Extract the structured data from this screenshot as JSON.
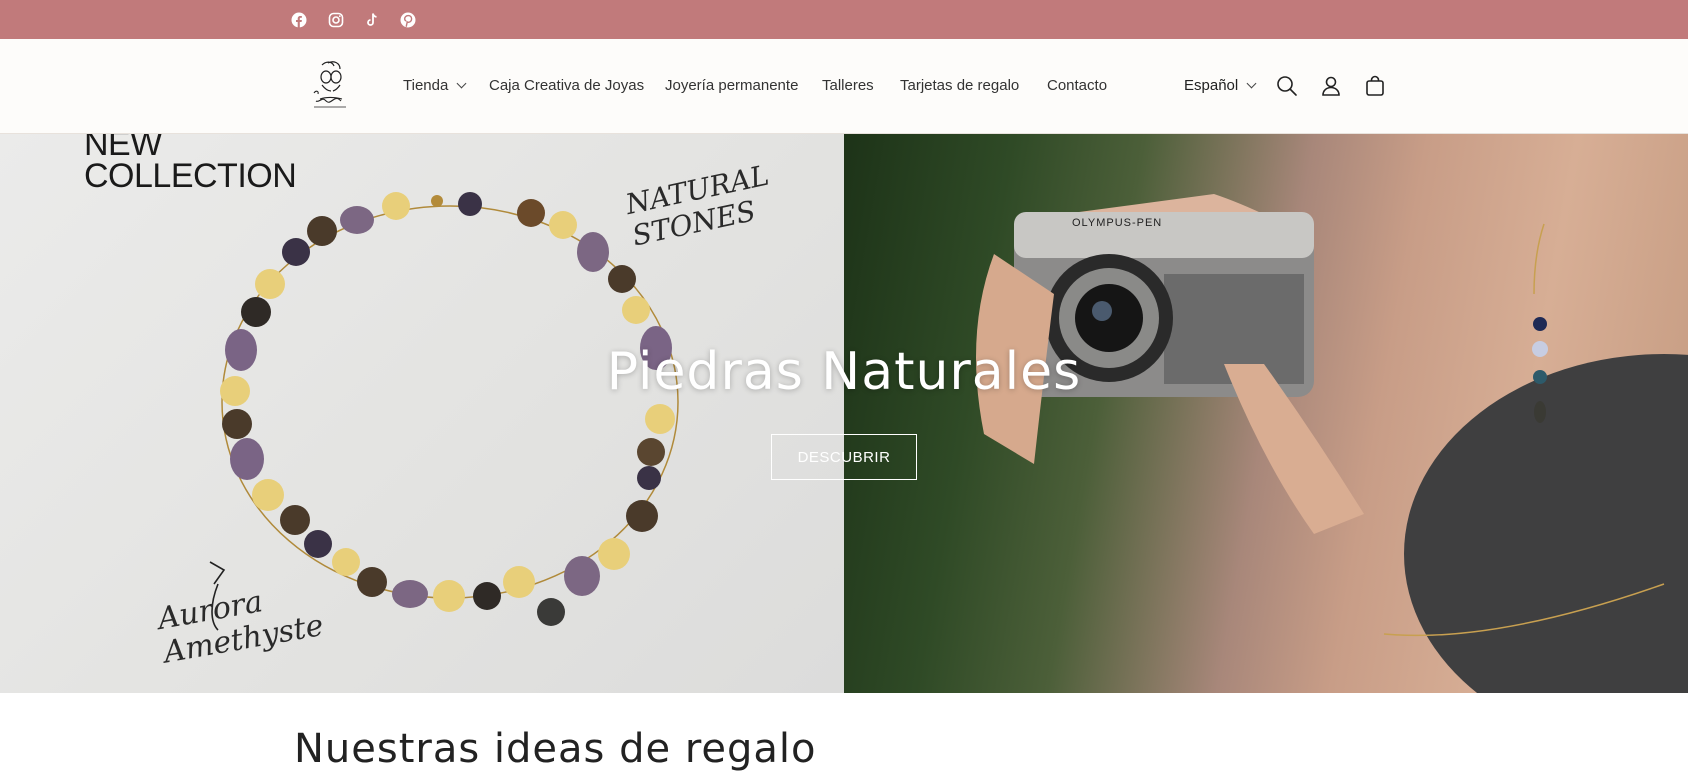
{
  "topbar": {
    "background": "#c17a7b",
    "social": [
      {
        "name": "facebook-icon"
      },
      {
        "name": "instagram-icon"
      },
      {
        "name": "tiktok-icon"
      },
      {
        "name": "pinterest-icon"
      }
    ]
  },
  "header": {
    "logo_alt": "Chic Pauletta Barcelona",
    "nav": [
      {
        "label": "Tienda",
        "has_dropdown": true
      },
      {
        "label": "Caja Creativa de Joyas"
      },
      {
        "label": "Joyería permanente"
      },
      {
        "label": "Talleres"
      },
      {
        "label": "Tarjetas de regalo"
      },
      {
        "label": "Contacto"
      }
    ],
    "language": "Español",
    "icons": [
      "search-icon",
      "account-icon",
      "cart-icon"
    ]
  },
  "hero": {
    "new_collection": "NEW\nCOLLECTION",
    "natural_stones": "NATURAL\nSTONES",
    "product_name": "Aurora\nAmethyste",
    "camera_brand": "OLYMPUS-PEN",
    "title": "Piedras Naturales",
    "button_label": "DESCUBRIR"
  },
  "section": {
    "title": "Nuestras ideas de regalo"
  }
}
